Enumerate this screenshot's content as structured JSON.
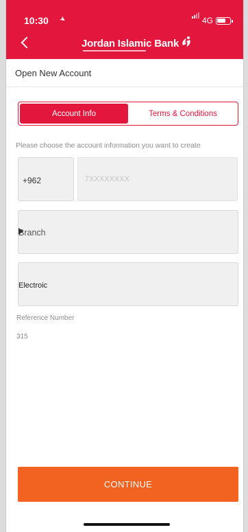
{
  "status_bar": {
    "time": "10:30",
    "network": "4G",
    "location_icon": "location-arrow-icon",
    "signal_icon": "signal-icon",
    "battery_icon": "battery-icon"
  },
  "header": {
    "back_icon": "chevron-left-icon",
    "logo_text": "Jordan Islamic Bank",
    "logo_icon": "bank-logo-mark",
    "color": "#e3173e"
  },
  "page": {
    "title": "Open New Account"
  },
  "tabs": [
    {
      "label": "Account Info",
      "active": true
    },
    {
      "label": "Terms & Conditions",
      "active": false
    }
  ],
  "form": {
    "hint": "Please choose the account information you want to create",
    "country_code": "+962",
    "phone_placeholder": "7XXXXXXXX",
    "branch_label": "Branch",
    "branch_caret_icon": "caret-right-icon",
    "account_type": "Electroic",
    "reference_label": "Reference Number",
    "reference_value": "315"
  },
  "actions": {
    "continue_label": "CONTINUE",
    "continue_color": "#f26321"
  }
}
